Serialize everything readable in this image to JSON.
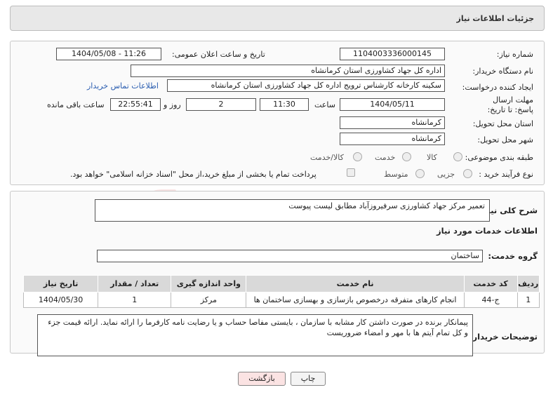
{
  "header": {
    "title": "جزئیات اطلاعات نیاز"
  },
  "form": {
    "need_number_label": "شماره نیاز:",
    "need_number": "1104003336000145",
    "announce_label": "تاریخ و ساعت اعلان عمومی:",
    "announce_value": "1404/05/08 - 11:26",
    "buyer_org_label": "نام دستگاه خریدار:",
    "buyer_org": "اداره کل جهاد کشاورزی استان کرمانشاه",
    "requester_label": "ایجاد کننده درخواست:",
    "requester": "سکینه کارخانه کارشناس ترویج اداره کل جهاد کشاورزی استان کرمانشاه",
    "contact_link": "اطلاعات تماس خریدار",
    "deadline_label": "مهلت ارسال پاسخ: تا تاریخ:",
    "deadline_date": "1404/05/11",
    "time_label": "ساعت",
    "deadline_time": "11:30",
    "days_value": "2",
    "days_label": "روز و",
    "remaining_time": "22:55:41",
    "remaining_label": "ساعت باقی مانده",
    "province_label": "استان محل تحویل:",
    "province": "کرمانشاه",
    "city_label": "شهر محل تحویل:",
    "city": "کرمانشاه",
    "category_label": "طبقه بندی موضوعی:",
    "category_options": [
      "کالا",
      "خدمت",
      "کالا/خدمت"
    ],
    "process_label": "نوع فرآیند خرید :",
    "process_options": [
      "جزیی",
      "متوسط"
    ],
    "payment_note": "پرداخت تمام یا بخشی از مبلغ خرید،از محل \"اسناد خزانه اسلامی\" خواهد بود."
  },
  "summary": {
    "label": "شرح کلی نیاز:",
    "text": "تعمیر مرکز جهاد کشاورزی سرفیروزآباد مطابق لیست پیوست"
  },
  "services": {
    "section_title": "اطلاعات خدمات مورد نیاز",
    "group_label": "گروه خدمت:",
    "group_value": "ساختمان",
    "columns": [
      "ردیف",
      "کد خدمت",
      "نام خدمت",
      "واحد اندازه گیری",
      "تعداد / مقدار",
      "تاریخ نیاز"
    ],
    "rows": [
      [
        "1",
        "ج-44",
        "انجام کارهای متفرقه درخصوص بازسازی و بهسازی ساختمان ها",
        "مرکز",
        "1",
        "1404/05/30"
      ]
    ]
  },
  "buyer_notes": {
    "label": "توضیحات خریدار:",
    "text": "پیمانکار برنده در صورت داشتن کار مشابه با سازمان ، بایستی مفاصا حساب و یا رضایت نامه کارفرما را ارائه نماید. ارائه قیمت جزء و کل تمام آیتم ها با مهر و امضاء ضروریست"
  },
  "buttons": {
    "print": "چاپ",
    "back": "بازگشت"
  },
  "watermark_text": "AriaTender.neT",
  "colors": {
    "link": "#2a5db0",
    "back_button_bg": "#fbe3e3",
    "watermark": "#d23a3a"
  }
}
